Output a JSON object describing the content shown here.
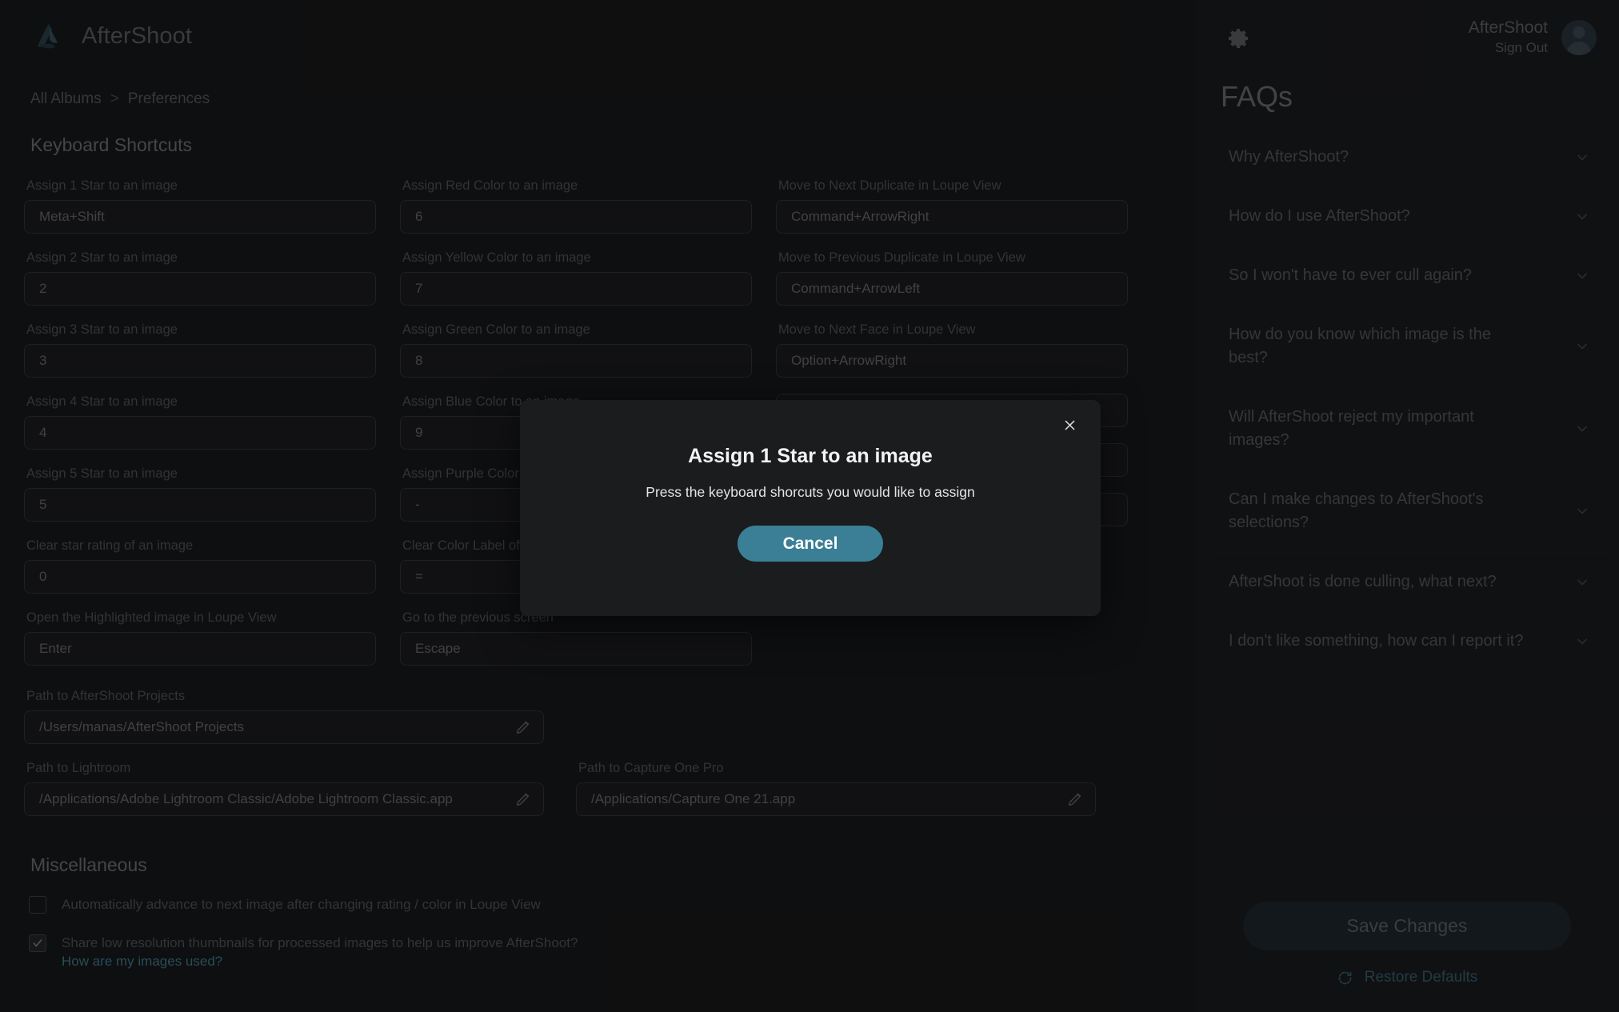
{
  "app": {
    "brand_name": "AfterShoot",
    "logo_icon": "aftershoot-logo-icon"
  },
  "breadcrumb": {
    "root": "All Albums",
    "separator": ">",
    "current": "Preferences"
  },
  "sections": {
    "keyboard_shortcuts_title": "Keyboard Shortcuts",
    "miscellaneous_title": "Miscellaneous"
  },
  "shortcuts": {
    "column1": [
      {
        "label": "Assign 1 Star to an image",
        "value": "Meta+Shift"
      },
      {
        "label": "Assign 2 Star to an image",
        "value": "2"
      },
      {
        "label": "Assign 3 Star to an image",
        "value": "3"
      },
      {
        "label": "Assign 4 Star to an image",
        "value": "4"
      },
      {
        "label": "Assign 5 Star to an image",
        "value": "5"
      },
      {
        "label": "Clear star rating of an image",
        "value": "0"
      },
      {
        "label": "Open the Highlighted image in Loupe View",
        "value": "Enter"
      }
    ],
    "column2": [
      {
        "label": "Assign Red Color to an image",
        "value": "6"
      },
      {
        "label": "Assign Yellow Color to an image",
        "value": "7"
      },
      {
        "label": "Assign Green Color to an image",
        "value": "8"
      },
      {
        "label": "Assign Blue Color to an image",
        "value": "9"
      },
      {
        "label": "Assign Purple Color to an image",
        "value": "-"
      },
      {
        "label": "Clear Color Label of an image",
        "value": "="
      },
      {
        "label": "Go to the previous screen",
        "value": "Escape"
      }
    ],
    "column3": [
      {
        "label": "Move to Next Duplicate in Loupe View",
        "value": "Command+ArrowRight"
      },
      {
        "label": "Move to Previous Duplicate in Loupe View",
        "value": "Command+ArrowLeft"
      },
      {
        "label": "Move to Next Face in Loupe View",
        "value": "Option+ArrowRight"
      },
      {
        "label": "",
        "value": ""
      },
      {
        "label": "",
        "value": ""
      },
      {
        "label": "",
        "value": ""
      }
    ]
  },
  "paths": {
    "projects": {
      "label": "Path to AfterShoot Projects",
      "value": "/Users/manas/AfterShoot Projects",
      "edit_icon": "pencil-icon"
    },
    "lightroom": {
      "label": "Path to Lightroom",
      "value": "/Applications/Adobe Lightroom Classic/Adobe Lightroom Classic.app",
      "edit_icon": "pencil-icon"
    },
    "capture_one": {
      "label": "Path to Capture One Pro",
      "value": "/Applications/Capture One 21.app",
      "edit_icon": "pencil-icon"
    }
  },
  "miscellaneous": {
    "options": [
      {
        "label": "Automatically advance to next image after changing rating / color in Loupe View",
        "checked": false,
        "link": ""
      },
      {
        "label": "Share low resolution thumbnails for processed images to help us improve AfterShoot?",
        "checked": true,
        "link": "How are my images used?"
      }
    ]
  },
  "topbar": {
    "gear_icon": "gear-icon",
    "account_name": "AfterShoot",
    "sign_out": "Sign Out",
    "avatar_icon": "avatar-icon"
  },
  "faq": {
    "title": "FAQs",
    "items": [
      {
        "question": "Why AfterShoot?",
        "chevron": "chevron-down-icon"
      },
      {
        "question": "How do I use AfterShoot?",
        "chevron": "chevron-down-icon"
      },
      {
        "question": "So I won't have to ever cull again?",
        "chevron": "chevron-down-icon"
      },
      {
        "question": "How do you know which image is the best?",
        "chevron": "chevron-down-icon"
      },
      {
        "question": "Will AfterShoot reject my important images?",
        "chevron": "chevron-down-icon"
      },
      {
        "question": "Can I make changes to AfterShoot's selections?",
        "chevron": "chevron-down-icon"
      },
      {
        "question": "AfterShoot is done culling, what next?",
        "chevron": "chevron-down-icon"
      },
      {
        "question": "I don't like something, how can I report it?",
        "chevron": "chevron-down-icon"
      }
    ]
  },
  "actions": {
    "save_label": "Save Changes",
    "restore_label": "Restore Defaults",
    "restore_icon": "restore-refresh-icon"
  },
  "modal": {
    "title": "Assign 1 Star to an image",
    "subtitle": "Press the keyboard shorcuts you would like to assign",
    "cancel_label": "Cancel",
    "close_icon": "close-icon",
    "accent_color": "#3a7f96"
  }
}
